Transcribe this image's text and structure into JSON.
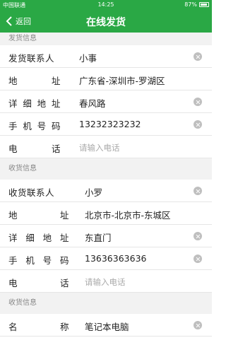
{
  "status_bar": {
    "carrier": "中国联通",
    "time": "14:25",
    "battery": "87%"
  },
  "nav": {
    "back_label": "返回",
    "title": "在线发货"
  },
  "sender": {
    "header": "发货信息",
    "contact_label": "发货联系人",
    "contact_value": "小事",
    "address_label_chars": [
      "地",
      "址"
    ],
    "address_value": "广东省-深圳市-罗湖区",
    "detail_label_chars": [
      "详",
      "细",
      "地",
      "址"
    ],
    "detail_value": "春风路",
    "mobile_label_chars": [
      "手",
      "机",
      "号",
      "码"
    ],
    "mobile_value": "13232323232",
    "phone_label_chars": [
      "电",
      "话"
    ],
    "phone_placeholder": "请输入电话"
  },
  "receiver": {
    "header": "收货信息",
    "contact_label": "收货联系人",
    "contact_value": "小罗",
    "address_label_chars": [
      "地",
      "址"
    ],
    "address_value": "北京市-北京市-东城区",
    "detail_label_chars": [
      "详",
      "细",
      "地",
      "址"
    ],
    "detail_value": "东直门",
    "mobile_label_chars": [
      "手",
      "机",
      "号",
      "码"
    ],
    "mobile_value": "13636363636",
    "phone_label_chars": [
      "电",
      "话"
    ],
    "phone_placeholder": "请输入电话"
  },
  "goods": {
    "header": "收货信息",
    "name_label_chars": [
      "名",
      "称"
    ],
    "name_value": "笔记本电脑"
  }
}
